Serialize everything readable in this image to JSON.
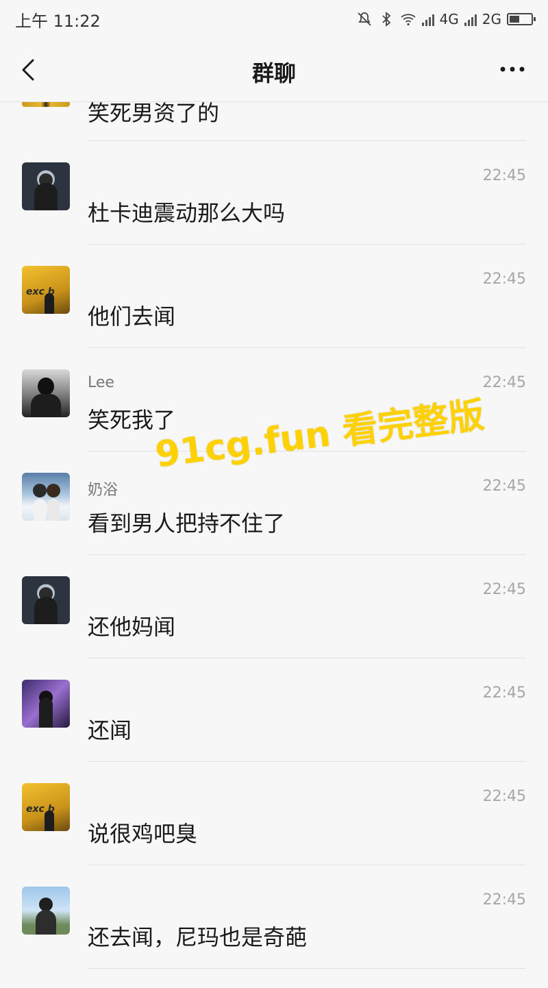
{
  "status_bar": {
    "time": "上午 11:22",
    "network_1": "4G",
    "network_2": "2G"
  },
  "nav": {
    "title": "群聊"
  },
  "partial_message": {
    "text": "笑死男资了的"
  },
  "messages": [
    {
      "avatar": "hero",
      "sender": "",
      "time": "22:45",
      "text": "杜卡迪震动那么大吗"
    },
    {
      "avatar": "club",
      "sender": "",
      "time": "22:45",
      "text": "他们去闻"
    },
    {
      "avatar": "girl",
      "sender": "Lee",
      "time": "22:45",
      "text": "笑死我了"
    },
    {
      "avatar": "couple",
      "sender": "奶浴",
      "time": "22:45",
      "text": "看到男人把持不住了"
    },
    {
      "avatar": "hero",
      "sender": "",
      "time": "22:45",
      "text": "还他妈闻"
    },
    {
      "avatar": "night",
      "sender": "",
      "time": "22:45",
      "text": "还闻"
    },
    {
      "avatar": "club",
      "sender": "",
      "time": "22:45",
      "text": "说很鸡吧臭"
    },
    {
      "avatar": "beach",
      "sender": "",
      "time": "22:45",
      "text": "还去闻，尼玛也是奇葩"
    }
  ],
  "watermark": "91cg.fun 看完整版",
  "avatar_tag": "exc b",
  "colors": {
    "background": "#f7f7f7",
    "divider": "#e2e2e2",
    "time": "#a6a6a6",
    "watermark": "#ffd100"
  }
}
